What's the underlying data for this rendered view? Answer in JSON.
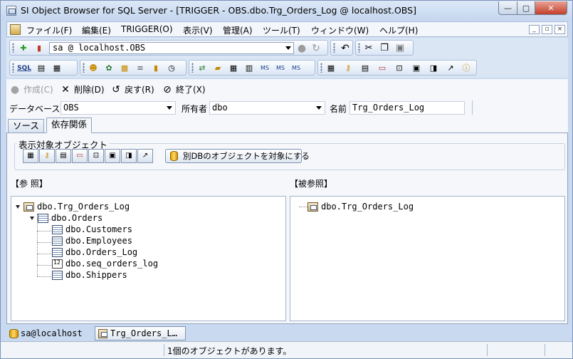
{
  "window": {
    "title": "SI Object Browser for SQL Server - [TRIGGER - OBS.dbo.Trg_Orders_Log @ localhost.OBS]",
    "min_glyph": "—",
    "max_glyph": "▢",
    "close_glyph": "✕"
  },
  "menu": {
    "items": [
      "ファイル(F)",
      "編集(E)",
      "TRIGGER(O)",
      "表示(V)",
      "管理(A)",
      "ツール(T)",
      "ウィンドウ(W)",
      "ヘルプ(H)"
    ],
    "mdi_min": "_",
    "mdi_restore": "▫",
    "mdi_close": "×"
  },
  "toolbar": {
    "connection_value": "sa @ localhost.OBS",
    "row2_icons": [
      "sql-icon",
      "script-icon",
      "grid-icon",
      "user-icon",
      "role-icon",
      "lock-icon",
      "database-icon",
      "cylinder-icon",
      "clock-icon",
      "refresh-icon",
      "folder-icon",
      "key-icon",
      "chart-icon",
      "ms-icon",
      "ms2-icon",
      "ms3-icon",
      "table-icon",
      "key2-icon",
      "calendar-icon",
      "window-icon",
      "view-icon",
      "procedure-icon",
      "index-icon",
      "link-icon",
      "info-icon"
    ],
    "sql_glyph": "SQL"
  },
  "actions": {
    "create": "作成(C)",
    "delete": "削除(D)",
    "revert": "戻す(R)",
    "exit": "終了(X)"
  },
  "filters": {
    "database_label": "データベース",
    "database_value": "OBS",
    "owner_label": "所有者",
    "owner_value": "dbo",
    "name_label": "名前",
    "name_value": "Trg_Orders_Log"
  },
  "tabs": {
    "source": "ソース",
    "dependency": "依存関係"
  },
  "dependency": {
    "group_title": "表示対象オブジェクト",
    "other_db_button": "別DBのオブジェクトを対象にする",
    "references_label": "【参 照】",
    "referenced_by_label": "【被参照】",
    "references_tree": [
      {
        "label": "dbo.Trg_Orders_Log",
        "type": "trigger"
      },
      {
        "label": "dbo.Orders",
        "type": "table"
      },
      {
        "label": "dbo.Customers",
        "type": "table"
      },
      {
        "label": "dbo.Employees",
        "type": "table"
      },
      {
        "label": "dbo.Orders_Log",
        "type": "table"
      },
      {
        "label": "dbo.seq_orders_log",
        "type": "sequence"
      },
      {
        "label": "dbo.Shippers",
        "type": "table"
      }
    ],
    "referenced_by_tree": [
      {
        "label": "dbo.Trg_Orders_Log",
        "type": "trigger"
      }
    ]
  },
  "doc_tabs": {
    "connection": "sa@localhost",
    "active": "Trg_Orders_L…"
  },
  "status": {
    "message": "1個のオブジェクトがあります。"
  },
  "colors": {
    "frame": "#c9daf0",
    "panel": "#f5f7fb",
    "close_red": "#c2402b"
  }
}
